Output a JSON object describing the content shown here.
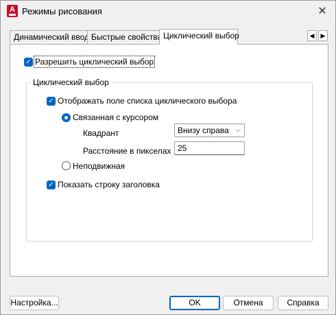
{
  "window": {
    "title": "Режимы рисования",
    "app_icon_letter": "A",
    "close_glyph": "✕"
  },
  "tabs": [
    {
      "label": "Динамический ввод",
      "active": false
    },
    {
      "label": "Быстрые свойства",
      "active": false
    },
    {
      "label": "Циклический выбор",
      "active": true
    }
  ],
  "tab_scroll": {
    "left": "◀",
    "right": "▶"
  },
  "panel": {
    "enable_cycling": {
      "label": "Разрешить циклический выбор",
      "checked": true
    },
    "group_title": "Циклический выбор",
    "show_list": {
      "label": "Отображать поле списка циклического выбора",
      "checked": true
    },
    "cursor_dependent": {
      "label": "Связанная с курсором",
      "selected": true
    },
    "quadrant": {
      "label": "Квадрант",
      "value": "Внизу справа"
    },
    "distance": {
      "label": "Расстояние в пикселах",
      "value": "25"
    },
    "static": {
      "label": "Неподвижная",
      "selected": false
    },
    "show_title_bar": {
      "label": "Показать строку заголовка",
      "checked": true
    }
  },
  "buttons": {
    "options": "Настройка...",
    "ok": "OK",
    "cancel": "Отмена",
    "help": "Справка"
  },
  "colors": {
    "accent": "#0067c0",
    "app_icon": "#c8102e"
  }
}
